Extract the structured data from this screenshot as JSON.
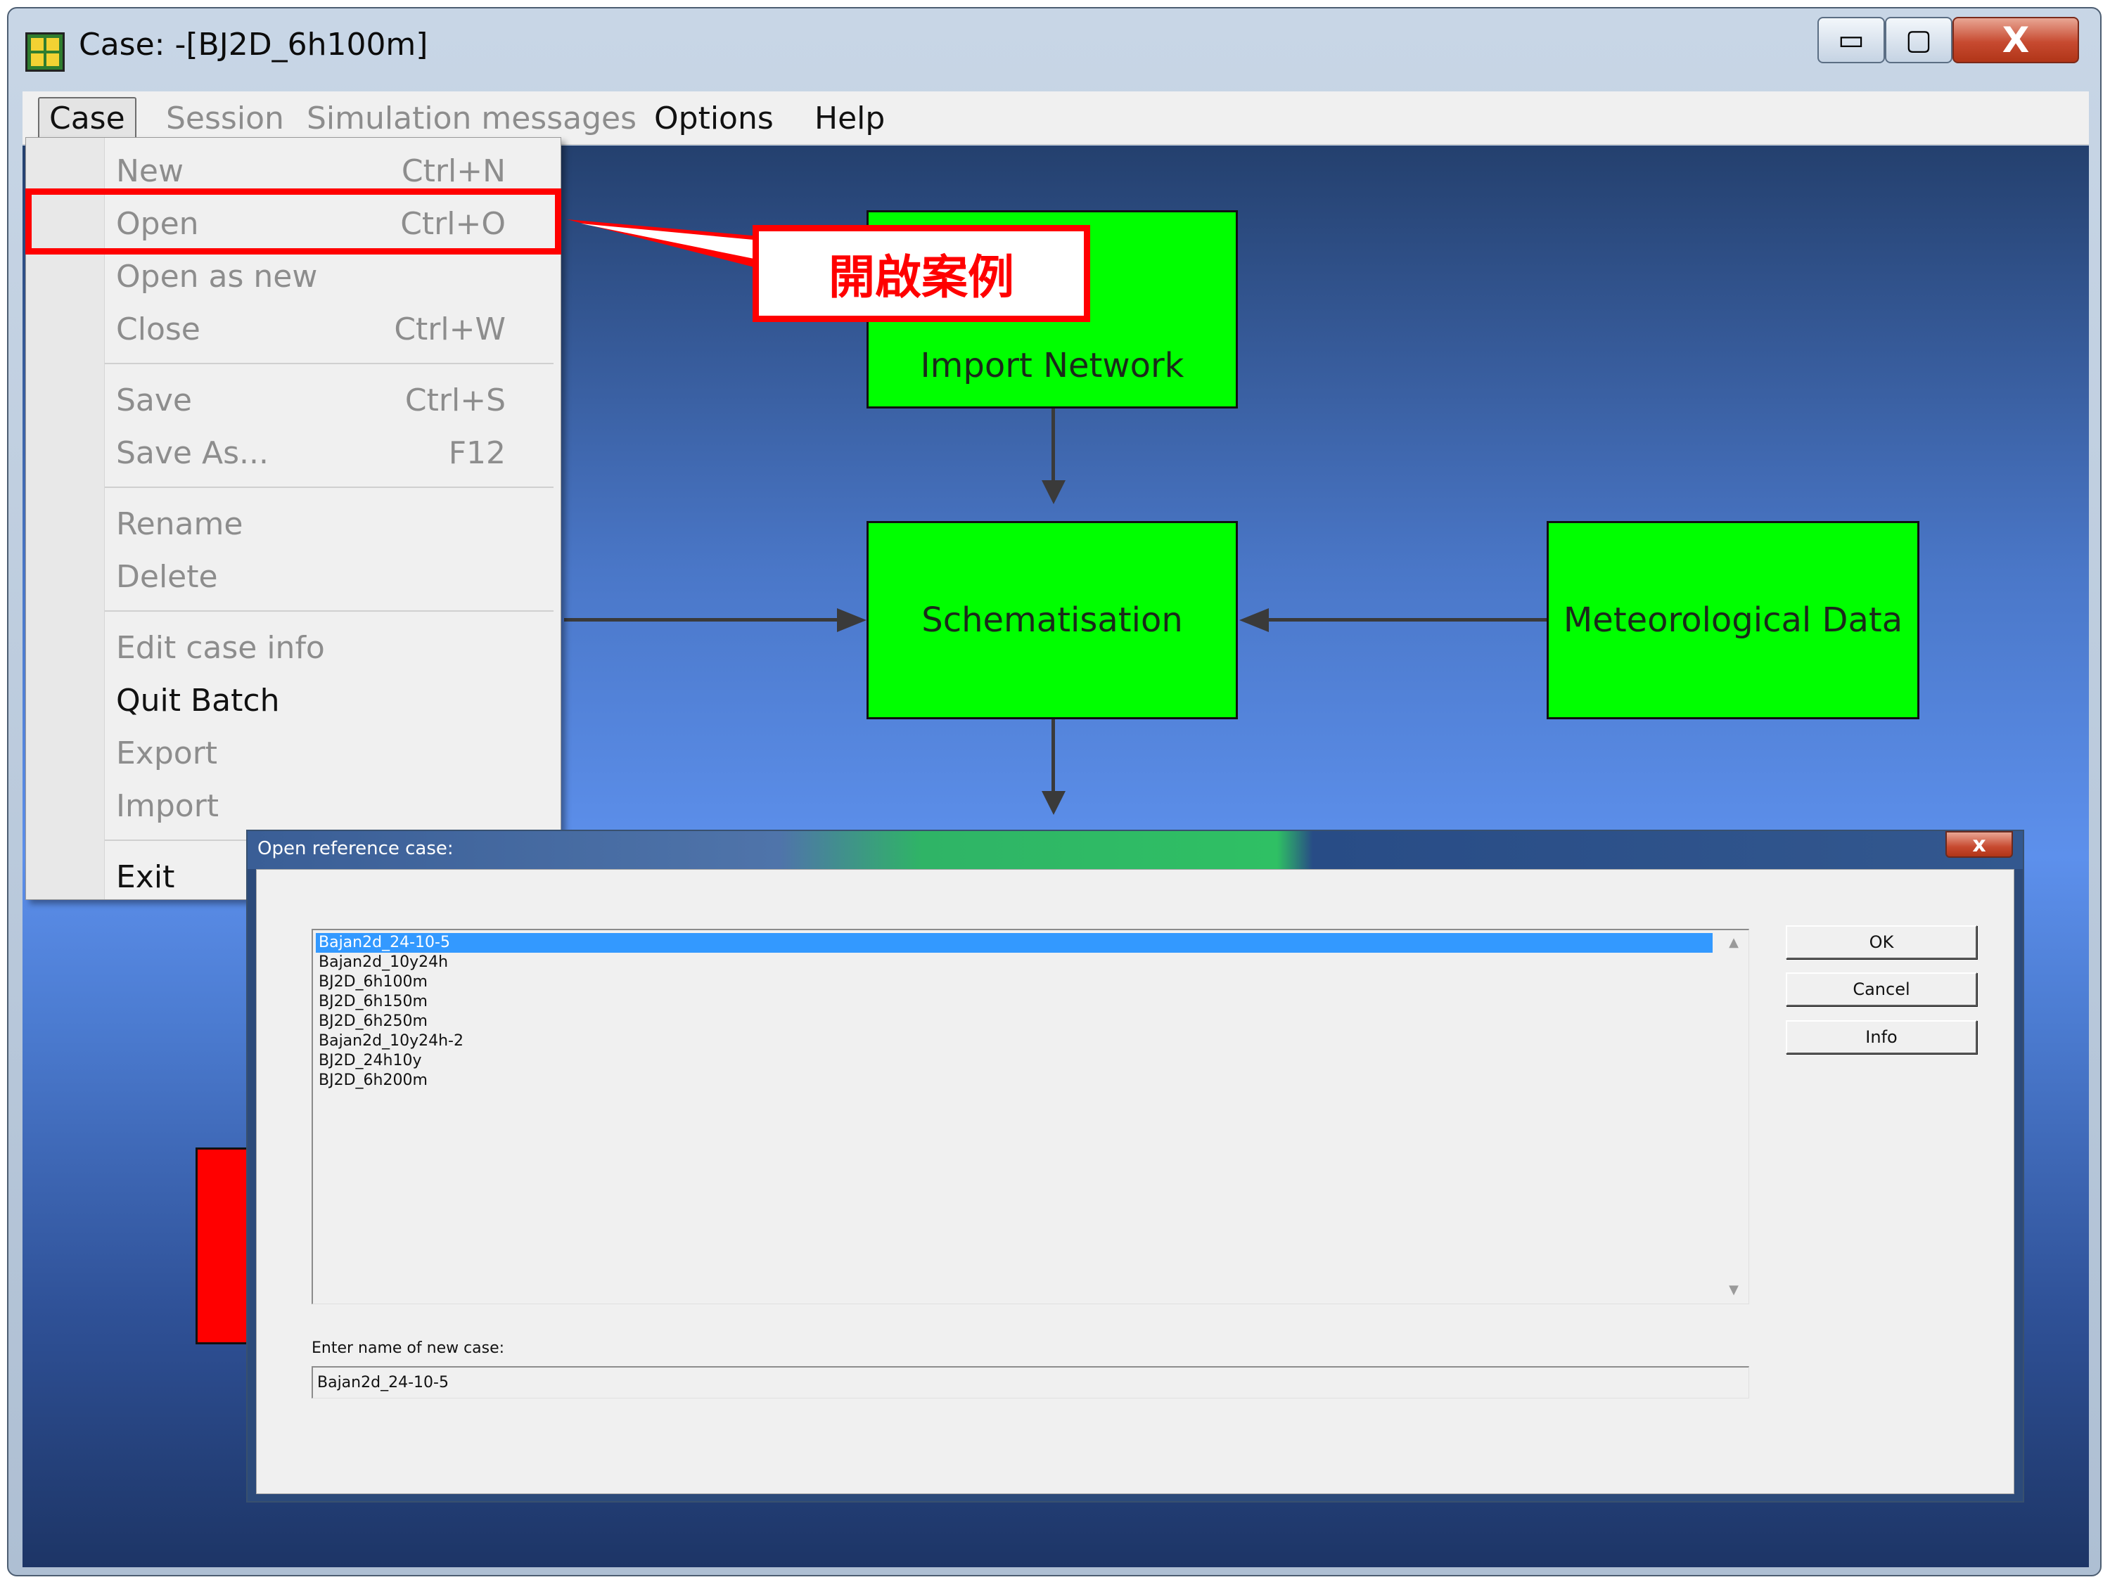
{
  "window": {
    "title": "Case: -[BJ2D_6h100m]",
    "min_glyph": "▭",
    "max_glyph": "▢",
    "close_glyph": "X"
  },
  "menubar": {
    "items": [
      {
        "label": "Case",
        "enabled": true
      },
      {
        "label": "Session",
        "enabled": false
      },
      {
        "label": "Simulation messages",
        "enabled": false
      },
      {
        "label": "Options",
        "enabled": true
      },
      {
        "label": "Help",
        "enabled": true
      }
    ]
  },
  "case_menu": {
    "groups": [
      [
        {
          "label": "New",
          "shortcut": "Ctrl+N",
          "enabled": false
        },
        {
          "label": "Open",
          "shortcut": "Ctrl+O",
          "enabled": false
        },
        {
          "label": "Open as new",
          "shortcut": "",
          "enabled": false
        },
        {
          "label": "Close",
          "shortcut": "Ctrl+W",
          "enabled": false
        }
      ],
      [
        {
          "label": "Save",
          "shortcut": "Ctrl+S",
          "enabled": false
        },
        {
          "label": "Save As...",
          "shortcut": "F12",
          "enabled": false
        }
      ],
      [
        {
          "label": "Rename",
          "shortcut": "",
          "enabled": false
        },
        {
          "label": "Delete",
          "shortcut": "",
          "enabled": false
        }
      ],
      [
        {
          "label": "Edit case info",
          "shortcut": "",
          "enabled": false
        },
        {
          "label": "Quit Batch",
          "shortcut": "",
          "enabled": true
        },
        {
          "label": "Export",
          "shortcut": "",
          "enabled": false
        },
        {
          "label": "Import",
          "shortcut": "",
          "enabled": false
        }
      ],
      [
        {
          "label": "Exit",
          "shortcut": "",
          "enabled": true
        }
      ]
    ]
  },
  "callout": {
    "text": "開啟案例",
    "color": "#ff0000"
  },
  "flowchart": {
    "import_network": "Import Network",
    "schematisation": "Schematisation",
    "meteorological_data": "Meteorological Data",
    "box_color": "#00ff00"
  },
  "dialog": {
    "title": "Open reference case:",
    "close_glyph": "x",
    "cases": [
      "Bajan2d_24-10-5",
      "Bajan2d_10y24h",
      "BJ2D_6h100m",
      "BJ2D_6h150m",
      "BJ2D_6h250m",
      "Bajan2d_10y24h-2",
      "BJ2D_24h10y",
      "BJ2D_6h200m"
    ],
    "selected_index": 0,
    "ok_label": "OK",
    "cancel_label": "Cancel",
    "info_label": "Info",
    "new_case_label": "Enter name of new case:",
    "new_case_value": "Bajan2d_24-10-5",
    "selection_color": "#3399ff"
  }
}
